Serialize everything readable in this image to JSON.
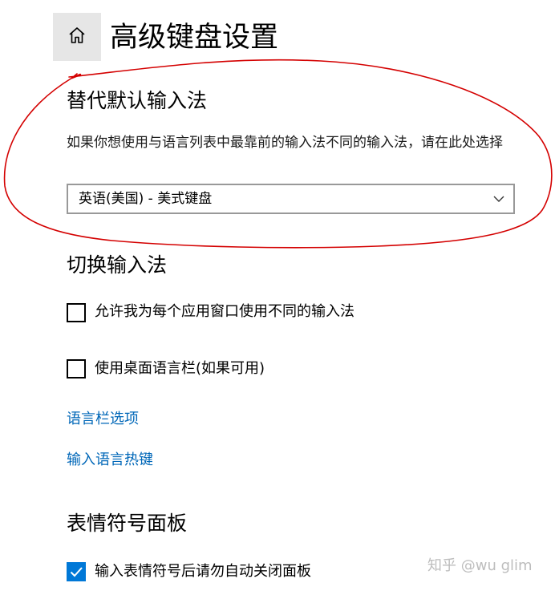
{
  "header": {
    "title": "高级键盘设置",
    "home_icon": "home-icon"
  },
  "override_section": {
    "heading": "替代默认输入法",
    "description": "如果你想使用与语言列表中最靠前的输入法不同的输入法，请在此处选择",
    "dropdown": {
      "selected_value": "英语(美国) - 美式键盘"
    }
  },
  "switch_section": {
    "heading": "切换输入法",
    "checkboxes": [
      {
        "label": "允许我为每个应用窗口使用不同的输入法",
        "checked": false
      },
      {
        "label": "使用桌面语言栏(如果可用)",
        "checked": false
      }
    ],
    "links": [
      {
        "label": "语言栏选项"
      },
      {
        "label": "输入语言热键"
      }
    ]
  },
  "emoji_section": {
    "heading": "表情符号面板",
    "checkboxes": [
      {
        "label": "输入表情符号后请勿自动关闭面板",
        "checked": true
      }
    ]
  },
  "watermark": {
    "text": "知乎 @wu glim"
  },
  "colors": {
    "accent": "#0078d7",
    "link": "#0067b8",
    "annotation": "#d40000"
  }
}
